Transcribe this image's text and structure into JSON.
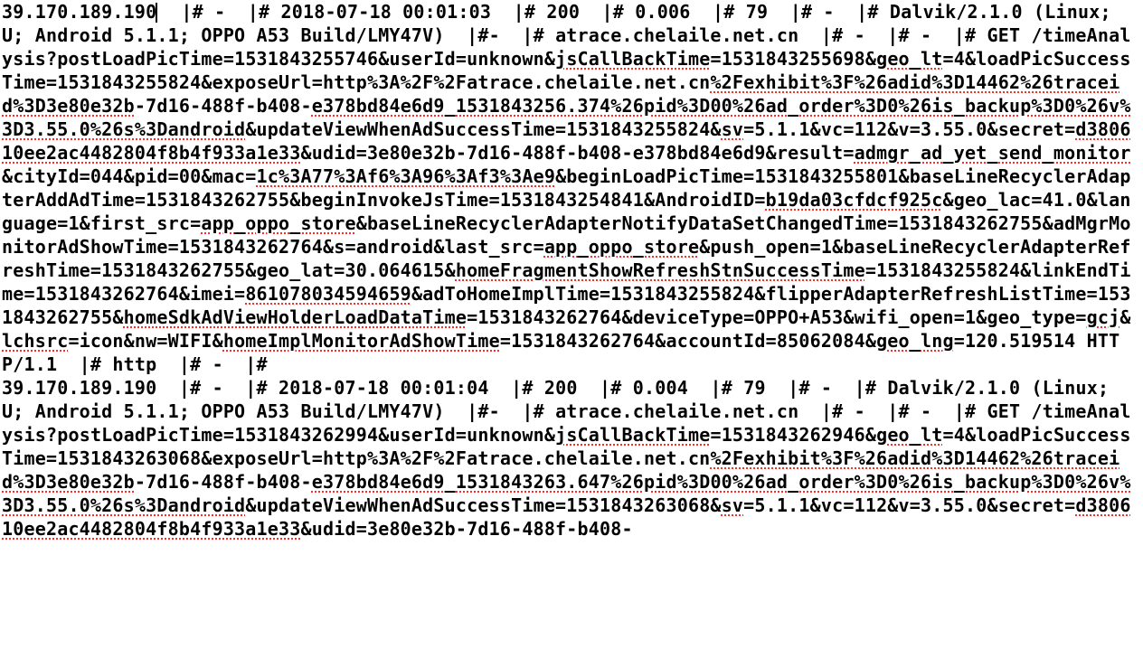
{
  "log": {
    "entry1": {
      "ip": "39.170.189.190",
      "sep1": "  |# -  |# ",
      "time": "2018-07-18 00:01:03",
      "sep2": "  |# ",
      "status": "200",
      "sep3": "  |# ",
      "duration": "0.006",
      "sep4": "  |# ",
      "bytes": "79",
      "sep5": "  |# -  |# ",
      "ua1": "Dalvik/2.1.0 (Linux; U; Android 5.1.1; OPPO A53 Build/LMY47V)",
      "sep6": "  |#-  |# ",
      "host": "atrace.chelaile.net.cn",
      "sep7": "  |# -  |# -  |# ",
      "method_path": "GET /timeAnalysis?",
      "q1a": "postLoadPicTime=1531843255746&userId=unknown&",
      "q1b": "jsCallBackTime",
      "q1c": "=1531843255698&",
      "q1d": "geo_lt",
      "q1e": "=4&loadPicSuccessTime=1531843255824&exposeUrl=http%3A%2F%2Fatrace.chelaile.net.cn",
      "q1f": "%2Fexhibit%3F%26adid%3D14462%26traceid%3D3e80e32b",
      "q1g": "-7d16-488f-b408-",
      "q1h": "e378bd84e6d9_1531843256.374%26pid%3D00%26ad_order%3D0%26is_backup%3D0%26v%3D3.55.0%26s%3Dandroid",
      "q1i": "&updateViewWhenAdSuccessTime=1531843255824&",
      "q1j": "sv",
      "q1k": "=5.1.1&vc=112&v=3.55.0&secret=",
      "q1l": "d380610ee2ac4482804f8b4f933a1e33",
      "q1m": "&udid=3e80e32b-7d16-488f-b408-e378bd84e6d9&result=",
      "q1n": "admgr_ad_yet_send_monitor",
      "q1o": "&cityId=044&pid=00&mac=",
      "q1p": "1c%3A77%3Af6%3A96%3Af3%3Ae9",
      "q1q": "&beginLoadPicTime=1531843255801&baseLineRecyclerAdapterAddAdTime=1531843262755&beginInvokeJsTime=1531843254841&AndroidID=",
      "q1r": "b19da03cfdcf925c",
      "q1s": "&geo_lac=41.0&language=1&first_src=",
      "q1t": "app_oppo_store",
      "q1u": "&baseLineRecyclerAdapterNotifyDataSetChangedTime=1531843262755&adMgrMonitorAdShowTime=1531843262764&s=android&last_src=",
      "q1v": "app_oppo_store",
      "q1w": "&push_open=1&baseLineRecyclerAdapterRefreshTime=1531843262755&geo_lat=30.064615&",
      "q1x": "homeFragmentShowRefreshStnSuccessTime",
      "q1y": "=1531843255824&linkEndTime=1531843262764&imei=",
      "q1z": "861078034594659",
      "q1aa": "&adToHomeImplTime=1531843255824&flipperAdapterRefreshListTime=1531843262755&",
      "q1ab": "homeSdkAdViewHolderLoadDataTime",
      "q1ac": "=1531843262764&deviceType=OPPO+A53&wifi_open=1&geo_type=",
      "q1ad": "gcj",
      "q1ae": "&",
      "q1af": "lchsrc",
      "q1ag": "=icon&nw=WIFI&",
      "q1ah": "homeImplMonitorAdShowTime",
      "q1ai": "=1531843262764&accountId=85062084&",
      "q1aj": "geo_lng",
      "q1ak": "=120.519514 HTTP/1.1  |# http  |# -  |#"
    },
    "entry2": {
      "ip": "39.170.189.190",
      "sep1": "  |# -  |# ",
      "time": "2018-07-18 00:01:04",
      "sep2": "  |# ",
      "status": "200",
      "sep3": "  |# ",
      "duration": "0.004",
      "sep4": "  |# ",
      "bytes": "79",
      "sep5": "  |# -  |# ",
      "ua1": "Dalvik/2.1.0 (Linux; U; Android 5.1.1; OPPO A53 Build/LMY47V)",
      "sep6": "  |#-  |# ",
      "host": "atrace.chelaile.net.cn",
      "sep7": "  |# -  |# -  |# ",
      "method_path": "GET /timeAnalysis?",
      "q2a": "postLoadPicTime=1531843262994&userId=unknown&",
      "q2b": "jsCallBackTime",
      "q2c": "=1531843262946&",
      "q2d": "geo_lt",
      "q2e": "=4&loadPicSuccessTime=1531843263068&exposeUrl=http%3A%2F%2Fatrace.chelaile.net.cn",
      "q2f": "%2Fexhibit%3F%26adid%3D14462%26traceid%3D3e80e32b",
      "q2g": "-7d16-488f-b408-",
      "q2h": "e378bd84e6d9_1531843263.647%26pid%3D00%26ad_order%3D0%26is_backup%3D0%26v%3D3.55.0%26s%3Dandroid",
      "q2i": "&updateViewWhenAdSuccessTime=1531843263068&",
      "q2j": "sv",
      "q2k": "=5.1.1&vc=112&v=3.55.0&secret=",
      "q2l": "d380610ee2ac4482804f8b4f933a1e33",
      "q2m": "&udid=3e80e32b-7d16-488f-b408-"
    }
  }
}
